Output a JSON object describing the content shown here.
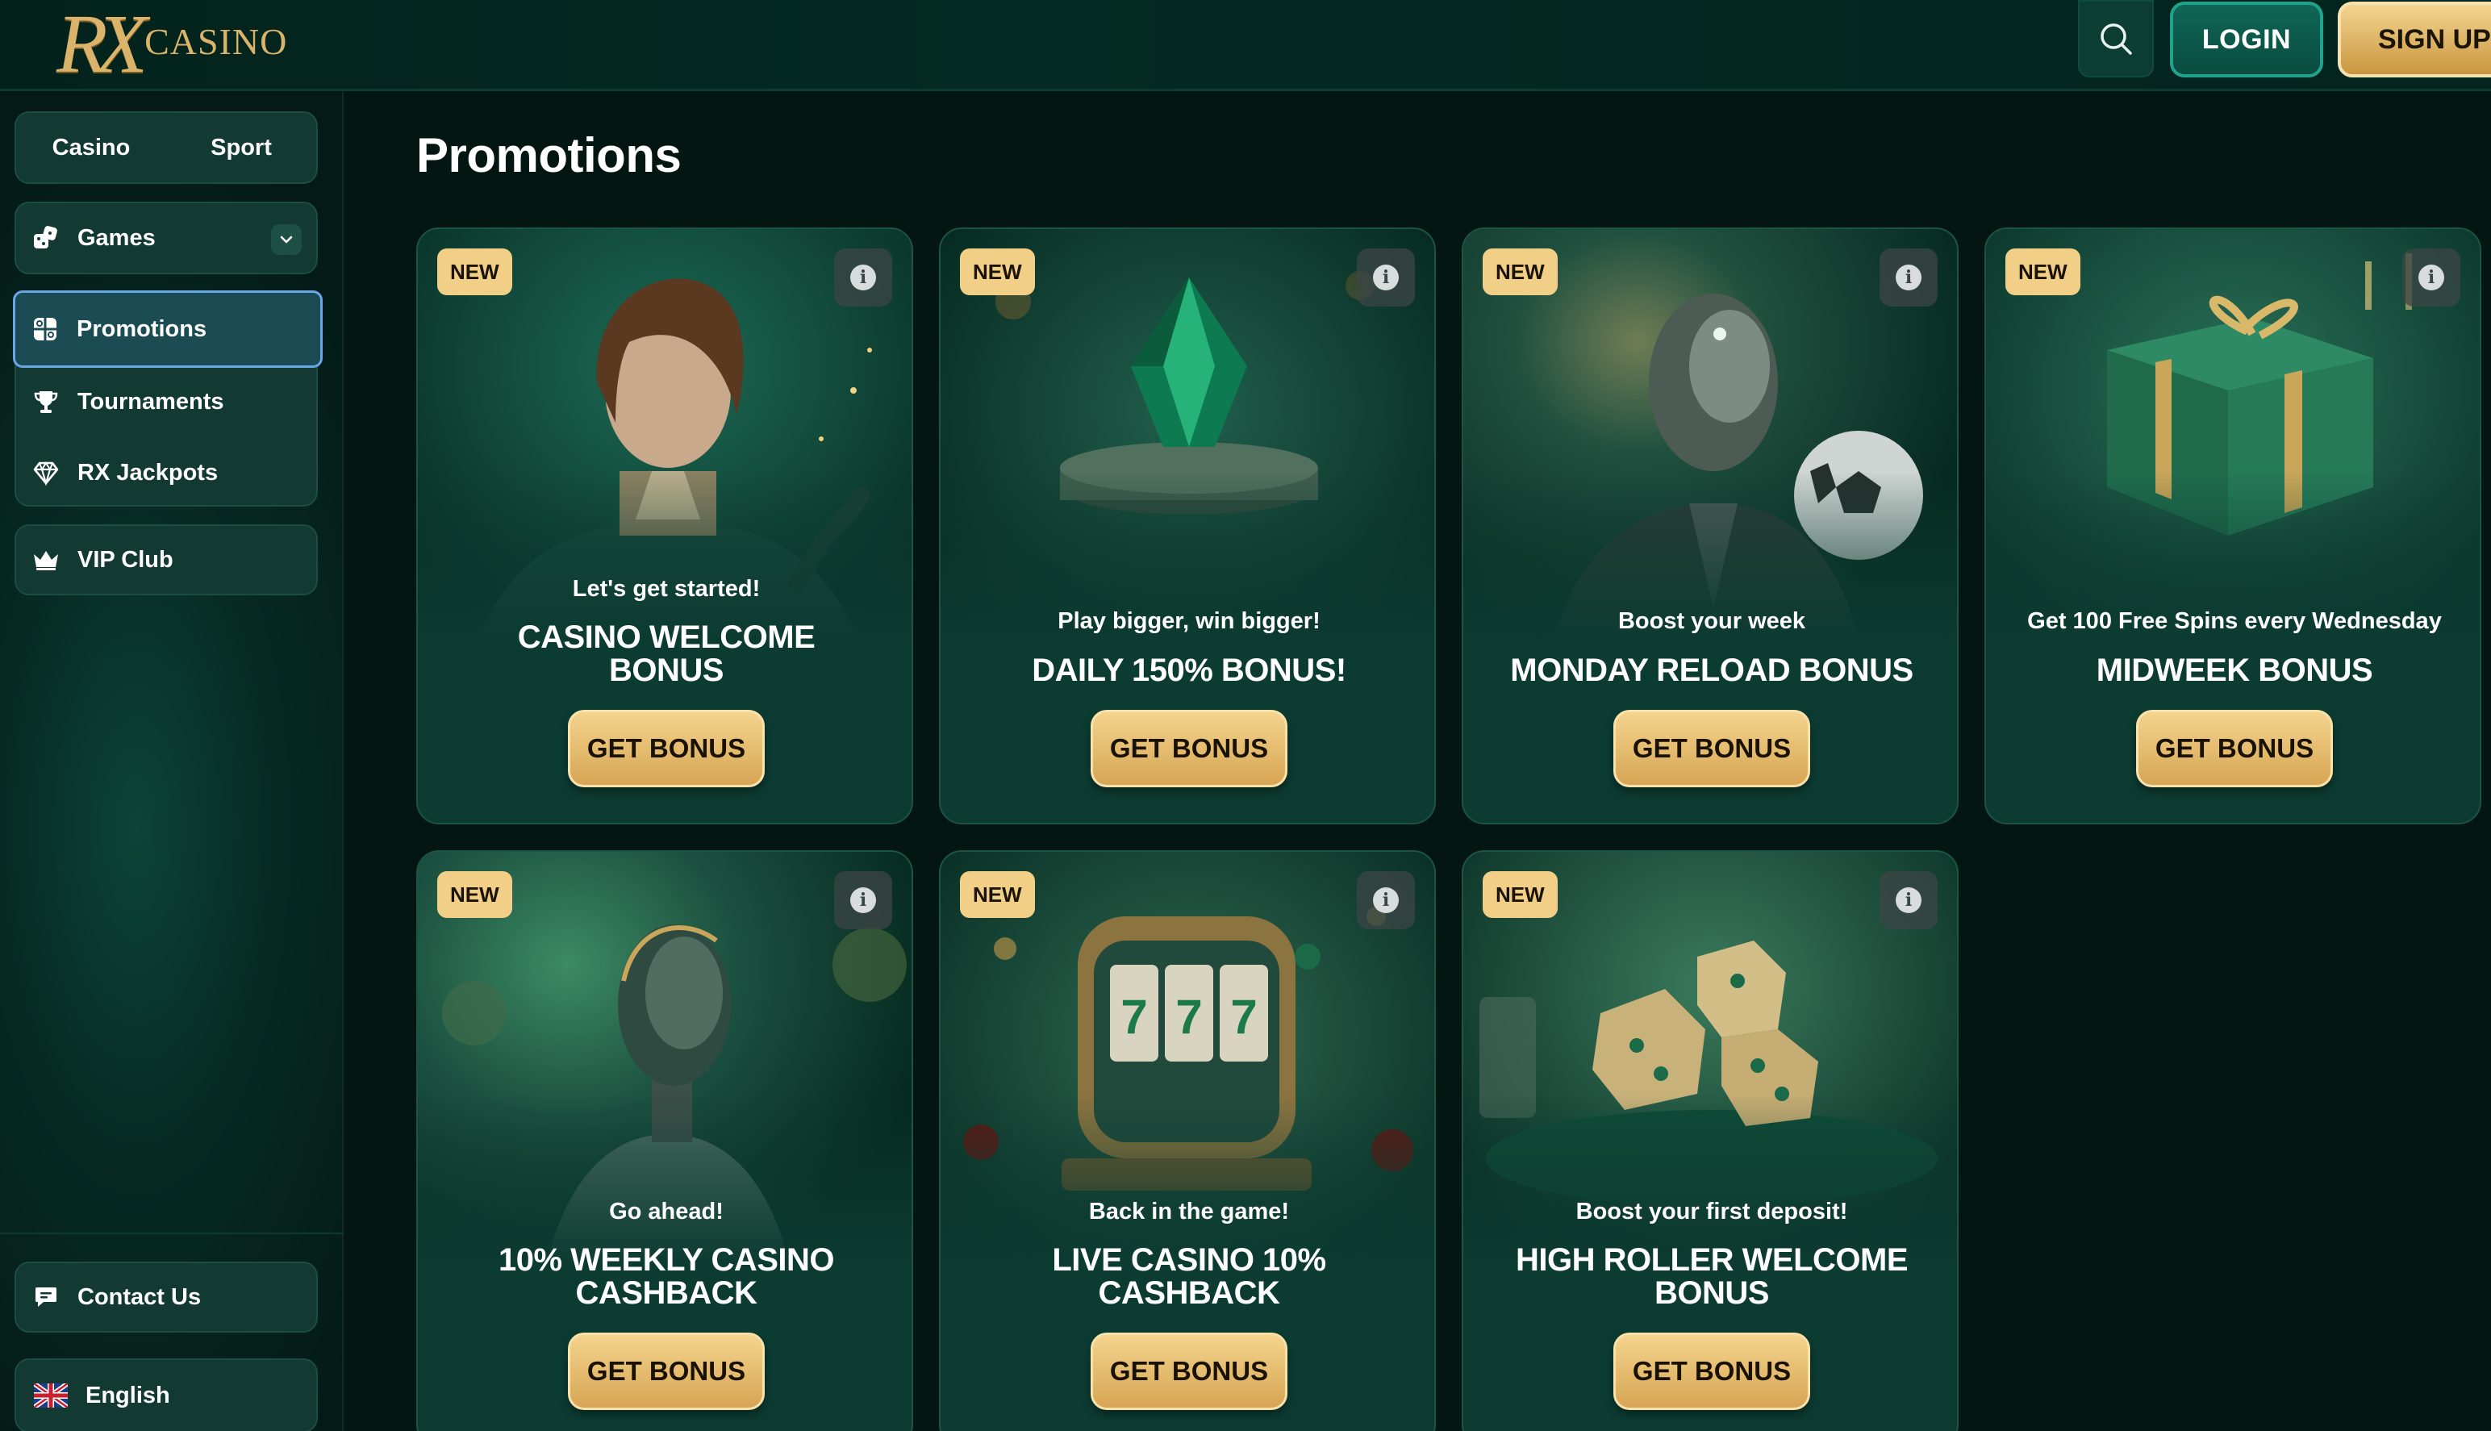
{
  "header": {
    "logo_mark": "RX",
    "logo_text": "CASINO",
    "login_label": "LOGIN",
    "signup_label": "SIGN UP"
  },
  "sidebar": {
    "toggle": [
      "Casino",
      "Sport"
    ],
    "games_label": "Games",
    "items": [
      {
        "label": "Promotions",
        "icon": "gift-grid-icon",
        "active": true
      },
      {
        "label": "Tournaments",
        "icon": "trophy-icon",
        "active": false
      },
      {
        "label": "RX Jackpots",
        "icon": "diamond-icon",
        "active": false
      }
    ],
    "vip_label": "VIP Club",
    "contact_label": "Contact Us",
    "language_label": "English"
  },
  "main": {
    "title": "Promotions",
    "badge_label": "NEW",
    "button_label": "GET BONUS",
    "promos": [
      {
        "subtitle": "Let's get started!",
        "title": "Casino Welcome Bonus",
        "art": "android-woman"
      },
      {
        "subtitle": "Play bigger, win bigger!",
        "title": "Daily 150% Bonus!",
        "art": "emerald-gem"
      },
      {
        "subtitle": "Boost your week",
        "title": "Monday Reload Bonus",
        "art": "robot-football"
      },
      {
        "subtitle": "Get 100 Free Spins every Wednesday",
        "title": "Midweek Bonus",
        "art": "gift-box"
      },
      {
        "subtitle": "Go ahead!",
        "title": "10% Weekly Casino Cashback",
        "art": "android-woman-2"
      },
      {
        "subtitle": "Back in the game!",
        "title": "Live Casino 10% Cashback",
        "art": "slot-machine"
      },
      {
        "subtitle": "Boost your first deposit!",
        "title": "High Roller Welcome Bonus",
        "art": "dice"
      }
    ]
  },
  "colors": {
    "background": "#041612",
    "card": "#0c3b31",
    "gold": "#f1cf86",
    "login_border": "#1fa38a",
    "active_border": "#6aa6e8"
  }
}
